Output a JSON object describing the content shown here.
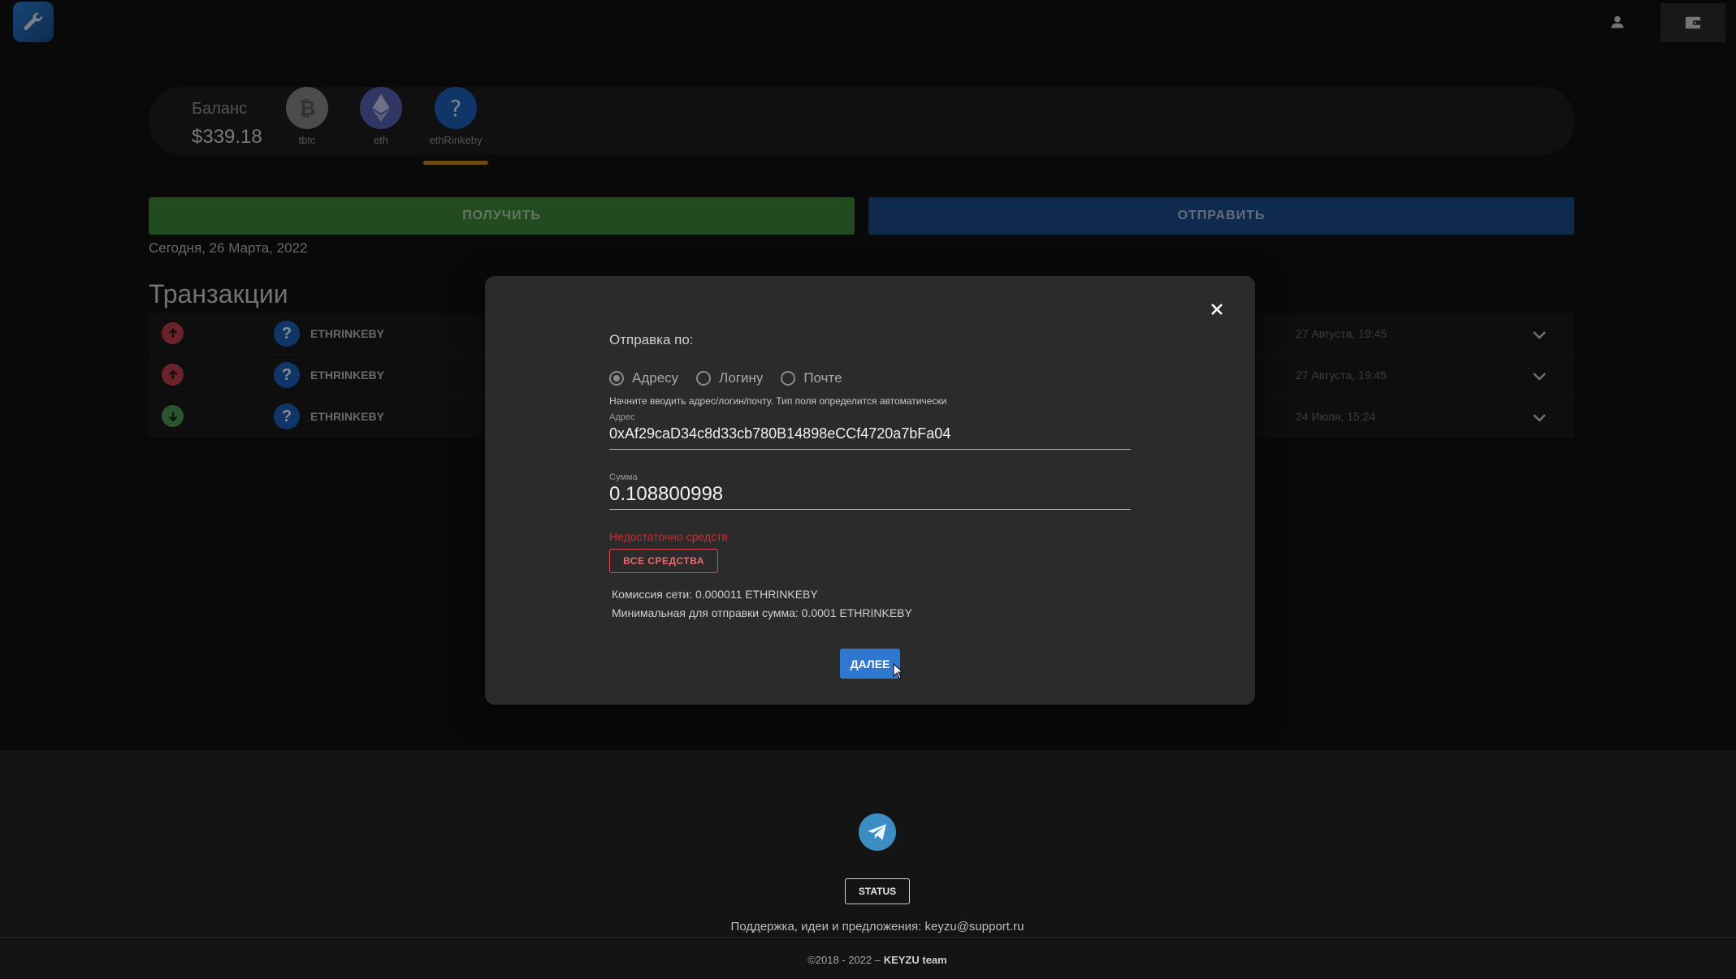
{
  "header": {
    "logo_icon": "wrench-icon",
    "user_icon": "user-icon",
    "wallet_icon": "wallet-icon"
  },
  "balance": {
    "label": "Баланс",
    "value": "$339.18",
    "coins": [
      {
        "label": "tbtc",
        "icon": "bitcoin-icon",
        "color": "#8a8a8a"
      },
      {
        "label": "eth",
        "icon": "ethereum-icon",
        "color": "#5865b8"
      },
      {
        "label": "ethRinkeby",
        "icon": "question-icon",
        "color": "#1e62c0",
        "selected": true
      }
    ]
  },
  "actions": {
    "receive_label": "ПОЛУЧИТЬ",
    "send_label": "ОТПРАВИТЬ"
  },
  "today_label": "Сегодня, 26 Марта, 2022",
  "transactions": {
    "heading": "Транзакции",
    "rows": [
      {
        "direction": "out",
        "coin": "ETHRINKEBY",
        "date": "27 Августа, 19:45"
      },
      {
        "direction": "out",
        "coin": "ETHRINKEBY",
        "date": "27 Августа, 19:45"
      },
      {
        "direction": "in",
        "coin": "ETHRINKEBY",
        "date": "24 Июля, 15:24"
      }
    ]
  },
  "modal": {
    "send_by_label": "Отправка по:",
    "options": [
      {
        "label": "Адресу",
        "checked": true
      },
      {
        "label": "Логину",
        "checked": false
      },
      {
        "label": "Почте",
        "checked": false
      }
    ],
    "hint": "Начните вводить адрес/логин/почту. Тип поля определится автоматически",
    "address_label": "Адрес",
    "address_value": "0xAf29caD34c8d33cb780B14898eCCf4720a7bFa04",
    "amount_label": "Сумма",
    "amount_value": "0.108800998",
    "error": "Недостаточно средств",
    "all_funds_label": "ВСЕ СРЕДСТВА",
    "fee_text": "Комиссия сети: 0.000011 ETHRINKEBY",
    "min_text": "Минимальная для отправки сумма: 0.0001 ETHRINKEBY",
    "next_label": "ДАЛЕЕ"
  },
  "footer": {
    "telegram_icon": "telegram-icon",
    "status_label": "STATUS",
    "support_text": "Поддержка, идеи и предложения: keyzu@support.ru",
    "copyright_prefix": "©2018 - 2022 – ",
    "copyright_team": "KEYZU team"
  },
  "colors": {
    "background": "#121212",
    "receive_green": "#3f8a3a",
    "send_blue": "#1e4d8f",
    "accent_blue": "#2f78d0",
    "error_red": "#d8262f",
    "out_red": "#c2414a",
    "in_green": "#4f9a59"
  }
}
